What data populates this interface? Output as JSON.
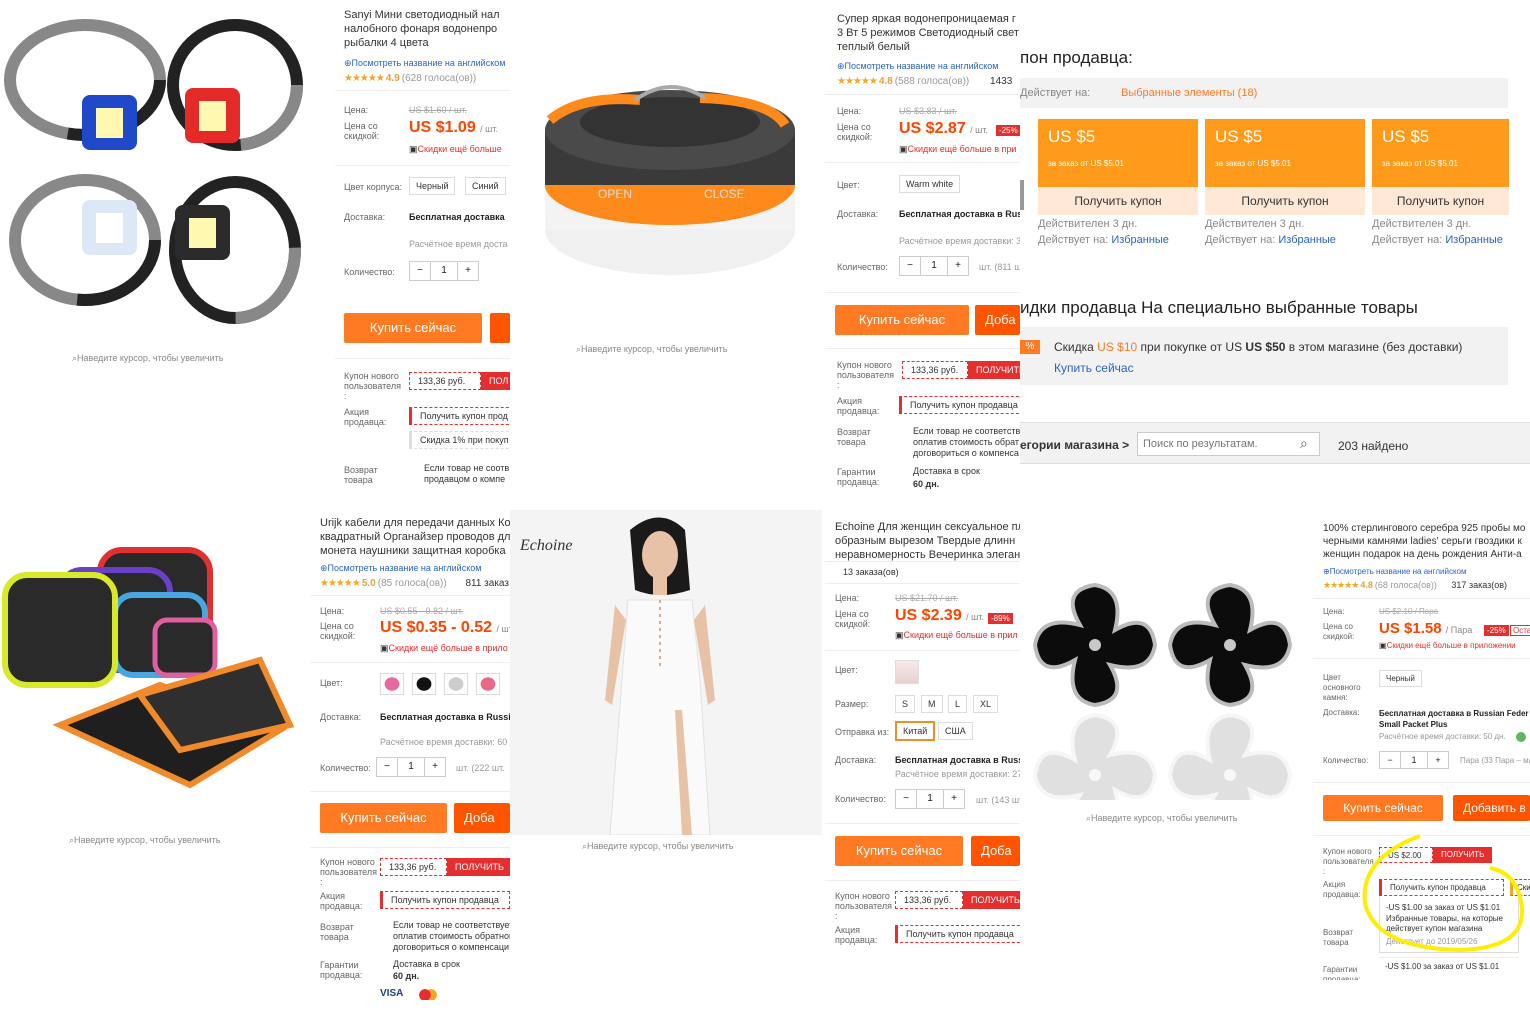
{
  "colors": {
    "accent": "#ff7a22",
    "price": "#ff4400",
    "coupon_card": "#ff9a1a",
    "highlight": "#ffee00"
  },
  "common": {
    "price_label": "Цена:",
    "discount_label": "Цена со\nскидкой:",
    "delivery_label": "Доставка:",
    "qty_label": "Количество:",
    "minus": "−",
    "plus": "+",
    "buy_now": "Купить сейчас",
    "add_cart": "Добавить в",
    "add_short": "Доба",
    "zoom_hint": "Наведите курсор, чтобы увеличить",
    "en_link": "Посмотреть название на английском",
    "new_user_label": "Купон нового\nпользователя\n:",
    "promo_label": "Акция\nпродавца:",
    "return_label": "Возврат\nтовара",
    "guarantee_label": "Гарантии\nпродавца:",
    "color_label": "Цвет:",
    "free_ship_ru": "Бесплатная доставка в Russian",
    "ship_time": "Расчётное время доставки:",
    "get": "ПОЛУЧИТЬ",
    "get_seller_coupon": "Получить купон продавца",
    "app_more": "Скидки ещё больше в приложении"
  },
  "panels": [
    {
      "id": "headlamp",
      "title": "Sanyi Мини светодиодный нал\nналобного фонаря водонепро\nрыбалки 4 цвета",
      "rating": "4.9",
      "votes": "(628 голоса(ов))",
      "old_price": "US $1.60 / шт.",
      "new_price": "US $1.09",
      "unit": "/ шт.",
      "app_text": "Скидки ещё больше",
      "body_color_label": "Цвет корпуса:",
      "options": [
        "Черный",
        "Синий"
      ],
      "ship": "Бесплатная доставка",
      "ship_sub": "Расчётное время доста",
      "qty": "1",
      "qty_rest": "шт. (",
      "coupon": "133,36 руб.",
      "coupon_get": "ПОЛ",
      "promo1": "Получить купон прод",
      "promo2": "Скидка 1% при покуп",
      "return_note": "Если товар не соотв\nпродавцом о компе"
    },
    {
      "id": "lantern",
      "title": "Супер яркая водонепроницаемая г\n3 Вт 5 режимов Светодиодный свет\nтеплый белый",
      "rating": "4.8",
      "votes": "(588 голоса(ов))",
      "orders": "1433",
      "old_price": "US $3.83 / шт.",
      "new_price": "US $2.87",
      "unit": "/ шт.",
      "discount": "-25%",
      "app_text": "Скидки ещё больше в при",
      "option": "Warm white",
      "ship": "Бесплатная доставка в Rus",
      "ship_sub": "Расчётное время доставки: 3",
      "qty": "1",
      "qty_rest": "шт. (811 ш",
      "open": "OPEN",
      "close": "CLOSE",
      "coupon": "133,36 руб.",
      "return_note": "Если товар не соответств\nоплатив стоимость обрат\nдоговориться о компенса",
      "guarantee": "Доставка в срок",
      "guarantee_days": "60 дн."
    },
    {
      "id": "seller",
      "coupon_title": "пон продавца:",
      "applies_label": "Действует на:",
      "applies_value": "Выбранные элементы (18)",
      "cards": [
        {
          "amount": "US $5",
          "order": "за заказ от US $5.01",
          "get": "Получить купон",
          "valid": "Действителен 3 дн.",
          "applies": "Избранные"
        },
        {
          "amount": "US $5",
          "order": "за заказ от US $5.01",
          "get": "Получить купон",
          "valid": "Действителен 3 дн.",
          "applies": "Избранные"
        },
        {
          "amount": "US $5",
          "order": "за заказ от US $5.01",
          "get": "Получить купон",
          "valid": "Действителен 3 дн.",
          "applies": "Избранные"
        }
      ],
      "discount_title": "идки продавца На специально выбранные товары",
      "pct": "%",
      "discount_text_1": "Скидка ",
      "discount_amt": "US $10",
      "discount_text_2": " при покупке от US ",
      "discount_min": "US $50",
      "discount_text_3": " в этом магазине (без доставки)",
      "buy_now_link": "Купить сейчас",
      "categories": "егории магазина >",
      "search_placeholder": "Поиск по результатам.",
      "found": "203 найдено"
    },
    {
      "id": "case",
      "title": "Urijk кабели для передачи данных Кор\nквадратный Органайзер проводов дл\nмонета наушники защитная коробка",
      "rating": "5.0",
      "votes": "(85 голоса(ов))",
      "orders": "811 заказ",
      "old_price": "US $0.55 - 0.82 / шт.",
      "new_price": "US $0.35 - 0.52",
      "unit": "/ шт.",
      "app_text": "Скидки ещё больше в прило",
      "ship": "Бесплатная доставка в Russian",
      "ship_sub": "Расчётное время доставки: 60 д",
      "qty": "1",
      "qty_rest": "шт. (222 шт.",
      "coupon": "133,36 руб.",
      "return_note": "Если товар не соответствует\nоплатив стоимость обратной\nдоговориться о компенсаци",
      "guarantee": "Доставка в срок",
      "guarantee_days": "60 дн.",
      "pay": "VISA"
    },
    {
      "id": "dress",
      "brand": "Echoine",
      "title": "Echoine Для женщин сексуальное пл\nобразным вырезом Твердые длинн\nнеравномерность Вечеринка элеган",
      "orders": "13 заказа(ов)",
      "old_price": "US $21.70 / шт.",
      "new_price": "US $2.39",
      "unit": "/ шт.",
      "discount": "-89%",
      "app_text": "Скидки ещё больше в прил",
      "size_label": "Размер:",
      "sizes": [
        "S",
        "M",
        "L",
        "XL"
      ],
      "ship_from_label": "Отправка из:",
      "ship_from": [
        "Китай",
        "США"
      ],
      "ship": "Бесплатная доставка в Russi",
      "ship_sub": "Расчётное время доставки: 27",
      "qty": "1",
      "qty_rest": "шт. (143 шт.",
      "coupon": "133,36 руб."
    },
    {
      "id": "earrings",
      "title": "100% стерлингового серебра 925 пробы мо\nчерными камнями ladies' серьги гвоздики к\nженщин подарок на день рождения Анти-а",
      "rating": "4.8",
      "votes": "(68 голоса(ов))",
      "orders": "317 заказ(ов)",
      "old_price": "US $2.10 / Пара",
      "new_price": "US $1.58",
      "unit": "/ Пара",
      "discount": "-25%",
      "discount2": "Оста",
      "app_text": "Скидки ещё больше в приложении",
      "stone_label": "Цвет\nосновного\nкамня:",
      "option": "Черный",
      "ship": "Бесплатная доставка в Russian Feder\nSmall Packet Plus",
      "ship_sub": "Расчётное время доставки: 50 дн.",
      "qty": "1",
      "qty_rest": "Пара (33 Пара – мак",
      "coupon": "US $2.00",
      "dropdown_line1": "-US $1.00 за заказ от US $1.01",
      "dropdown_line2": "Избранные товары, на которые\nдействует купон магазина",
      "dropdown_valid": "Действует до 2019/05/26",
      "dropdown_line3": "-US $1.00 за заказ от US $1.01",
      "extra": "Ски"
    }
  ]
}
